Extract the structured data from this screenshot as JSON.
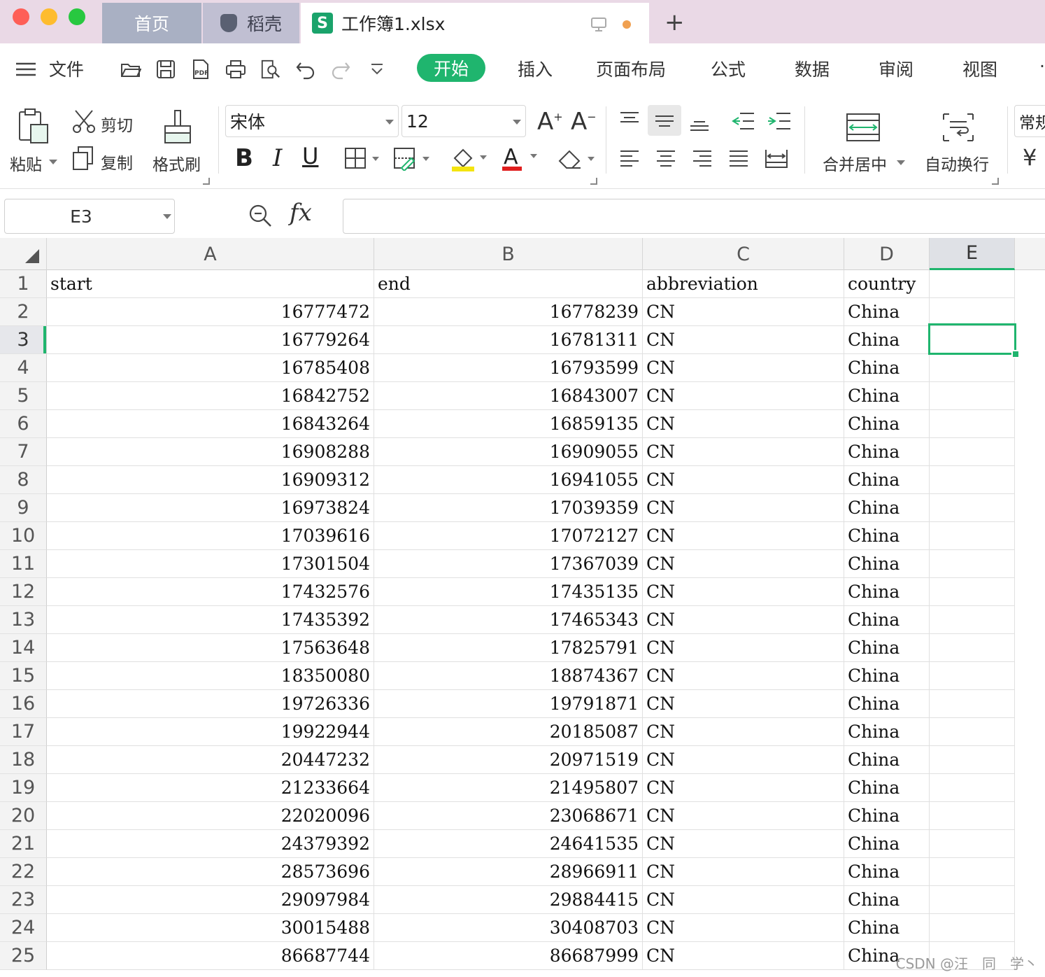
{
  "window": {
    "traffic_colors": [
      "#fe5f57",
      "#febc2e",
      "#28c840"
    ],
    "tabs": [
      {
        "label": "首页"
      },
      {
        "label": "稻壳"
      },
      {
        "label": "工作簿1.xlsx"
      }
    ],
    "new_tab": "+",
    "active_tab_icon_letter": "S"
  },
  "menu": {
    "file": "文件",
    "items": [
      "开始",
      "插入",
      "页面布局",
      "公式",
      "数据",
      "审阅",
      "视图"
    ]
  },
  "ribbon": {
    "paste": "粘贴",
    "cut": "剪切",
    "copy": "复制",
    "format_painter": "格式刷",
    "font_name": "宋体",
    "font_size": "12",
    "bold": "B",
    "italic": "I",
    "underline": "U",
    "merge_center": "合并居中",
    "wrap_text": "自动换行",
    "style_cut": "常规"
  },
  "formula_bar": {
    "name_box": "E3",
    "fx_label": "fx",
    "formula": ""
  },
  "sheet": {
    "columns": [
      "A",
      "B",
      "C",
      "D",
      "E"
    ],
    "selected_column": "E",
    "selected_row": 3,
    "selected_cell": "E3",
    "rows": [
      {
        "n": "1",
        "a": "start",
        "b": "end",
        "c": "abbreviation",
        "d": "country",
        "e": ""
      },
      {
        "n": "2",
        "a": "16777472",
        "b": "16778239",
        "c": "CN",
        "d": "China",
        "e": ""
      },
      {
        "n": "3",
        "a": "16779264",
        "b": "16781311",
        "c": "CN",
        "d": "China",
        "e": ""
      },
      {
        "n": "4",
        "a": "16785408",
        "b": "16793599",
        "c": "CN",
        "d": "China",
        "e": ""
      },
      {
        "n": "5",
        "a": "16842752",
        "b": "16843007",
        "c": "CN",
        "d": "China",
        "e": ""
      },
      {
        "n": "6",
        "a": "16843264",
        "b": "16859135",
        "c": "CN",
        "d": "China",
        "e": ""
      },
      {
        "n": "7",
        "a": "16908288",
        "b": "16909055",
        "c": "CN",
        "d": "China",
        "e": ""
      },
      {
        "n": "8",
        "a": "16909312",
        "b": "16941055",
        "c": "CN",
        "d": "China",
        "e": ""
      },
      {
        "n": "9",
        "a": "16973824",
        "b": "17039359",
        "c": "CN",
        "d": "China",
        "e": ""
      },
      {
        "n": "10",
        "a": "17039616",
        "b": "17072127",
        "c": "CN",
        "d": "China",
        "e": ""
      },
      {
        "n": "11",
        "a": "17301504",
        "b": "17367039",
        "c": "CN",
        "d": "China",
        "e": ""
      },
      {
        "n": "12",
        "a": "17432576",
        "b": "17435135",
        "c": "CN",
        "d": "China",
        "e": ""
      },
      {
        "n": "13",
        "a": "17435392",
        "b": "17465343",
        "c": "CN",
        "d": "China",
        "e": ""
      },
      {
        "n": "14",
        "a": "17563648",
        "b": "17825791",
        "c": "CN",
        "d": "China",
        "e": ""
      },
      {
        "n": "15",
        "a": "18350080",
        "b": "18874367",
        "c": "CN",
        "d": "China",
        "e": ""
      },
      {
        "n": "16",
        "a": "19726336",
        "b": "19791871",
        "c": "CN",
        "d": "China",
        "e": ""
      },
      {
        "n": "17",
        "a": "19922944",
        "b": "20185087",
        "c": "CN",
        "d": "China",
        "e": ""
      },
      {
        "n": "18",
        "a": "20447232",
        "b": "20971519",
        "c": "CN",
        "d": "China",
        "e": ""
      },
      {
        "n": "19",
        "a": "21233664",
        "b": "21495807",
        "c": "CN",
        "d": "China",
        "e": ""
      },
      {
        "n": "20",
        "a": "22020096",
        "b": "23068671",
        "c": "CN",
        "d": "China",
        "e": ""
      },
      {
        "n": "21",
        "a": "24379392",
        "b": "24641535",
        "c": "CN",
        "d": "China",
        "e": ""
      },
      {
        "n": "22",
        "a": "28573696",
        "b": "28966911",
        "c": "CN",
        "d": "China",
        "e": ""
      },
      {
        "n": "23",
        "a": "29097984",
        "b": "29884415",
        "c": "CN",
        "d": "China",
        "e": ""
      },
      {
        "n": "24",
        "a": "30015488",
        "b": "30408703",
        "c": "CN",
        "d": "China",
        "e": ""
      },
      {
        "n": "25",
        "a": "86687744",
        "b": "86687999",
        "c": "CN",
        "d": "China",
        "e": ""
      }
    ]
  },
  "watermark": "CSDN @汪　同　学丶",
  "colors": {
    "accent": "#1fb56e",
    "titlebar": "#ead9e6",
    "home_tab": "#a9b0c3",
    "daoke_tab": "#c0bfd2"
  }
}
